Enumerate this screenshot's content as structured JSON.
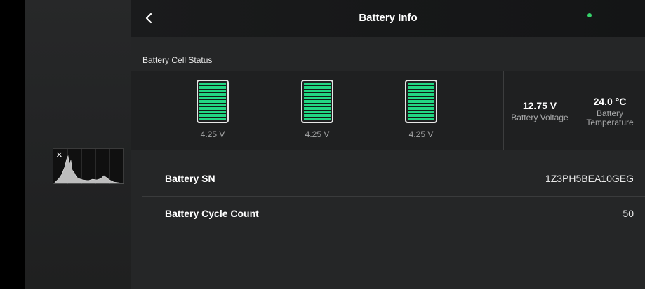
{
  "header": {
    "title": "Battery Info"
  },
  "histogram": {
    "close_symbol": "×"
  },
  "cell_status": {
    "label": "Battery Cell Status",
    "cells": [
      {
        "voltage": "4.25 V"
      },
      {
        "voltage": "4.25 V"
      },
      {
        "voltage": "4.25 V"
      }
    ],
    "voltage": {
      "value": "12.75 V",
      "label": "Battery Voltage"
    },
    "temperature": {
      "value": "24.0 °C",
      "label_line1": "Battery",
      "label_line2": "Temperature"
    }
  },
  "details": [
    {
      "label": "Battery SN",
      "value": "1Z3PH5BEA10GEG"
    },
    {
      "label": "Battery Cycle Count",
      "value": "50"
    }
  ],
  "colors": {
    "accent_green": "#22d783",
    "status_dot": "#35d26a"
  },
  "icons": {
    "back": "chevron-left-icon",
    "close": "close-icon",
    "battery": "battery-icon"
  }
}
